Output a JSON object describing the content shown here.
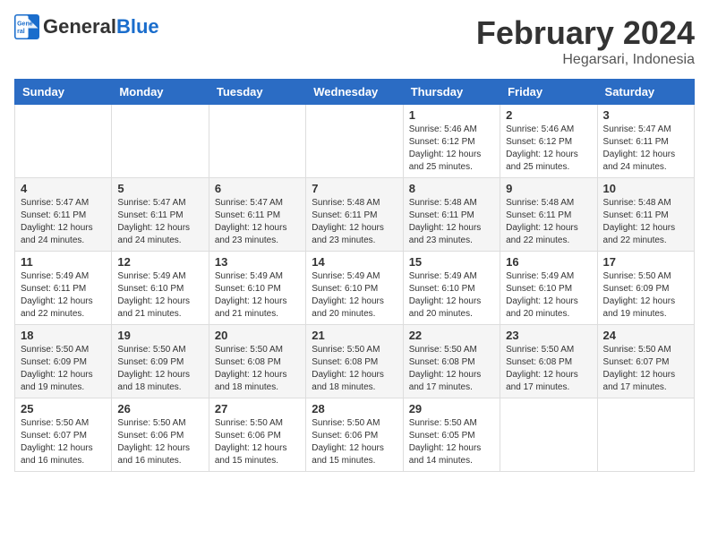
{
  "header": {
    "logo_general": "General",
    "logo_blue": "Blue",
    "month_year": "February 2024",
    "location": "Hegarsari, Indonesia"
  },
  "days_of_week": [
    "Sunday",
    "Monday",
    "Tuesday",
    "Wednesday",
    "Thursday",
    "Friday",
    "Saturday"
  ],
  "weeks": [
    [
      {
        "day": "",
        "sunrise": "",
        "sunset": "",
        "daylight": ""
      },
      {
        "day": "",
        "sunrise": "",
        "sunset": "",
        "daylight": ""
      },
      {
        "day": "",
        "sunrise": "",
        "sunset": "",
        "daylight": ""
      },
      {
        "day": "",
        "sunrise": "",
        "sunset": "",
        "daylight": ""
      },
      {
        "day": "1",
        "sunrise": "Sunrise: 5:46 AM",
        "sunset": "Sunset: 6:12 PM",
        "daylight": "Daylight: 12 hours and 25 minutes."
      },
      {
        "day": "2",
        "sunrise": "Sunrise: 5:46 AM",
        "sunset": "Sunset: 6:12 PM",
        "daylight": "Daylight: 12 hours and 25 minutes."
      },
      {
        "day": "3",
        "sunrise": "Sunrise: 5:47 AM",
        "sunset": "Sunset: 6:11 PM",
        "daylight": "Daylight: 12 hours and 24 minutes."
      }
    ],
    [
      {
        "day": "4",
        "sunrise": "Sunrise: 5:47 AM",
        "sunset": "Sunset: 6:11 PM",
        "daylight": "Daylight: 12 hours and 24 minutes."
      },
      {
        "day": "5",
        "sunrise": "Sunrise: 5:47 AM",
        "sunset": "Sunset: 6:11 PM",
        "daylight": "Daylight: 12 hours and 24 minutes."
      },
      {
        "day": "6",
        "sunrise": "Sunrise: 5:47 AM",
        "sunset": "Sunset: 6:11 PM",
        "daylight": "Daylight: 12 hours and 23 minutes."
      },
      {
        "day": "7",
        "sunrise": "Sunrise: 5:48 AM",
        "sunset": "Sunset: 6:11 PM",
        "daylight": "Daylight: 12 hours and 23 minutes."
      },
      {
        "day": "8",
        "sunrise": "Sunrise: 5:48 AM",
        "sunset": "Sunset: 6:11 PM",
        "daylight": "Daylight: 12 hours and 23 minutes."
      },
      {
        "day": "9",
        "sunrise": "Sunrise: 5:48 AM",
        "sunset": "Sunset: 6:11 PM",
        "daylight": "Daylight: 12 hours and 22 minutes."
      },
      {
        "day": "10",
        "sunrise": "Sunrise: 5:48 AM",
        "sunset": "Sunset: 6:11 PM",
        "daylight": "Daylight: 12 hours and 22 minutes."
      }
    ],
    [
      {
        "day": "11",
        "sunrise": "Sunrise: 5:49 AM",
        "sunset": "Sunset: 6:11 PM",
        "daylight": "Daylight: 12 hours and 22 minutes."
      },
      {
        "day": "12",
        "sunrise": "Sunrise: 5:49 AM",
        "sunset": "Sunset: 6:10 PM",
        "daylight": "Daylight: 12 hours and 21 minutes."
      },
      {
        "day": "13",
        "sunrise": "Sunrise: 5:49 AM",
        "sunset": "Sunset: 6:10 PM",
        "daylight": "Daylight: 12 hours and 21 minutes."
      },
      {
        "day": "14",
        "sunrise": "Sunrise: 5:49 AM",
        "sunset": "Sunset: 6:10 PM",
        "daylight": "Daylight: 12 hours and 20 minutes."
      },
      {
        "day": "15",
        "sunrise": "Sunrise: 5:49 AM",
        "sunset": "Sunset: 6:10 PM",
        "daylight": "Daylight: 12 hours and 20 minutes."
      },
      {
        "day": "16",
        "sunrise": "Sunrise: 5:49 AM",
        "sunset": "Sunset: 6:10 PM",
        "daylight": "Daylight: 12 hours and 20 minutes."
      },
      {
        "day": "17",
        "sunrise": "Sunrise: 5:50 AM",
        "sunset": "Sunset: 6:09 PM",
        "daylight": "Daylight: 12 hours and 19 minutes."
      }
    ],
    [
      {
        "day": "18",
        "sunrise": "Sunrise: 5:50 AM",
        "sunset": "Sunset: 6:09 PM",
        "daylight": "Daylight: 12 hours and 19 minutes."
      },
      {
        "day": "19",
        "sunrise": "Sunrise: 5:50 AM",
        "sunset": "Sunset: 6:09 PM",
        "daylight": "Daylight: 12 hours and 18 minutes."
      },
      {
        "day": "20",
        "sunrise": "Sunrise: 5:50 AM",
        "sunset": "Sunset: 6:08 PM",
        "daylight": "Daylight: 12 hours and 18 minutes."
      },
      {
        "day": "21",
        "sunrise": "Sunrise: 5:50 AM",
        "sunset": "Sunset: 6:08 PM",
        "daylight": "Daylight: 12 hours and 18 minutes."
      },
      {
        "day": "22",
        "sunrise": "Sunrise: 5:50 AM",
        "sunset": "Sunset: 6:08 PM",
        "daylight": "Daylight: 12 hours and 17 minutes."
      },
      {
        "day": "23",
        "sunrise": "Sunrise: 5:50 AM",
        "sunset": "Sunset: 6:08 PM",
        "daylight": "Daylight: 12 hours and 17 minutes."
      },
      {
        "day": "24",
        "sunrise": "Sunrise: 5:50 AM",
        "sunset": "Sunset: 6:07 PM",
        "daylight": "Daylight: 12 hours and 17 minutes."
      }
    ],
    [
      {
        "day": "25",
        "sunrise": "Sunrise: 5:50 AM",
        "sunset": "Sunset: 6:07 PM",
        "daylight": "Daylight: 12 hours and 16 minutes."
      },
      {
        "day": "26",
        "sunrise": "Sunrise: 5:50 AM",
        "sunset": "Sunset: 6:06 PM",
        "daylight": "Daylight: 12 hours and 16 minutes."
      },
      {
        "day": "27",
        "sunrise": "Sunrise: 5:50 AM",
        "sunset": "Sunset: 6:06 PM",
        "daylight": "Daylight: 12 hours and 15 minutes."
      },
      {
        "day": "28",
        "sunrise": "Sunrise: 5:50 AM",
        "sunset": "Sunset: 6:06 PM",
        "daylight": "Daylight: 12 hours and 15 minutes."
      },
      {
        "day": "29",
        "sunrise": "Sunrise: 5:50 AM",
        "sunset": "Sunset: 6:05 PM",
        "daylight": "Daylight: 12 hours and 14 minutes."
      },
      {
        "day": "",
        "sunrise": "",
        "sunset": "",
        "daylight": ""
      },
      {
        "day": "",
        "sunrise": "",
        "sunset": "",
        "daylight": ""
      }
    ]
  ]
}
